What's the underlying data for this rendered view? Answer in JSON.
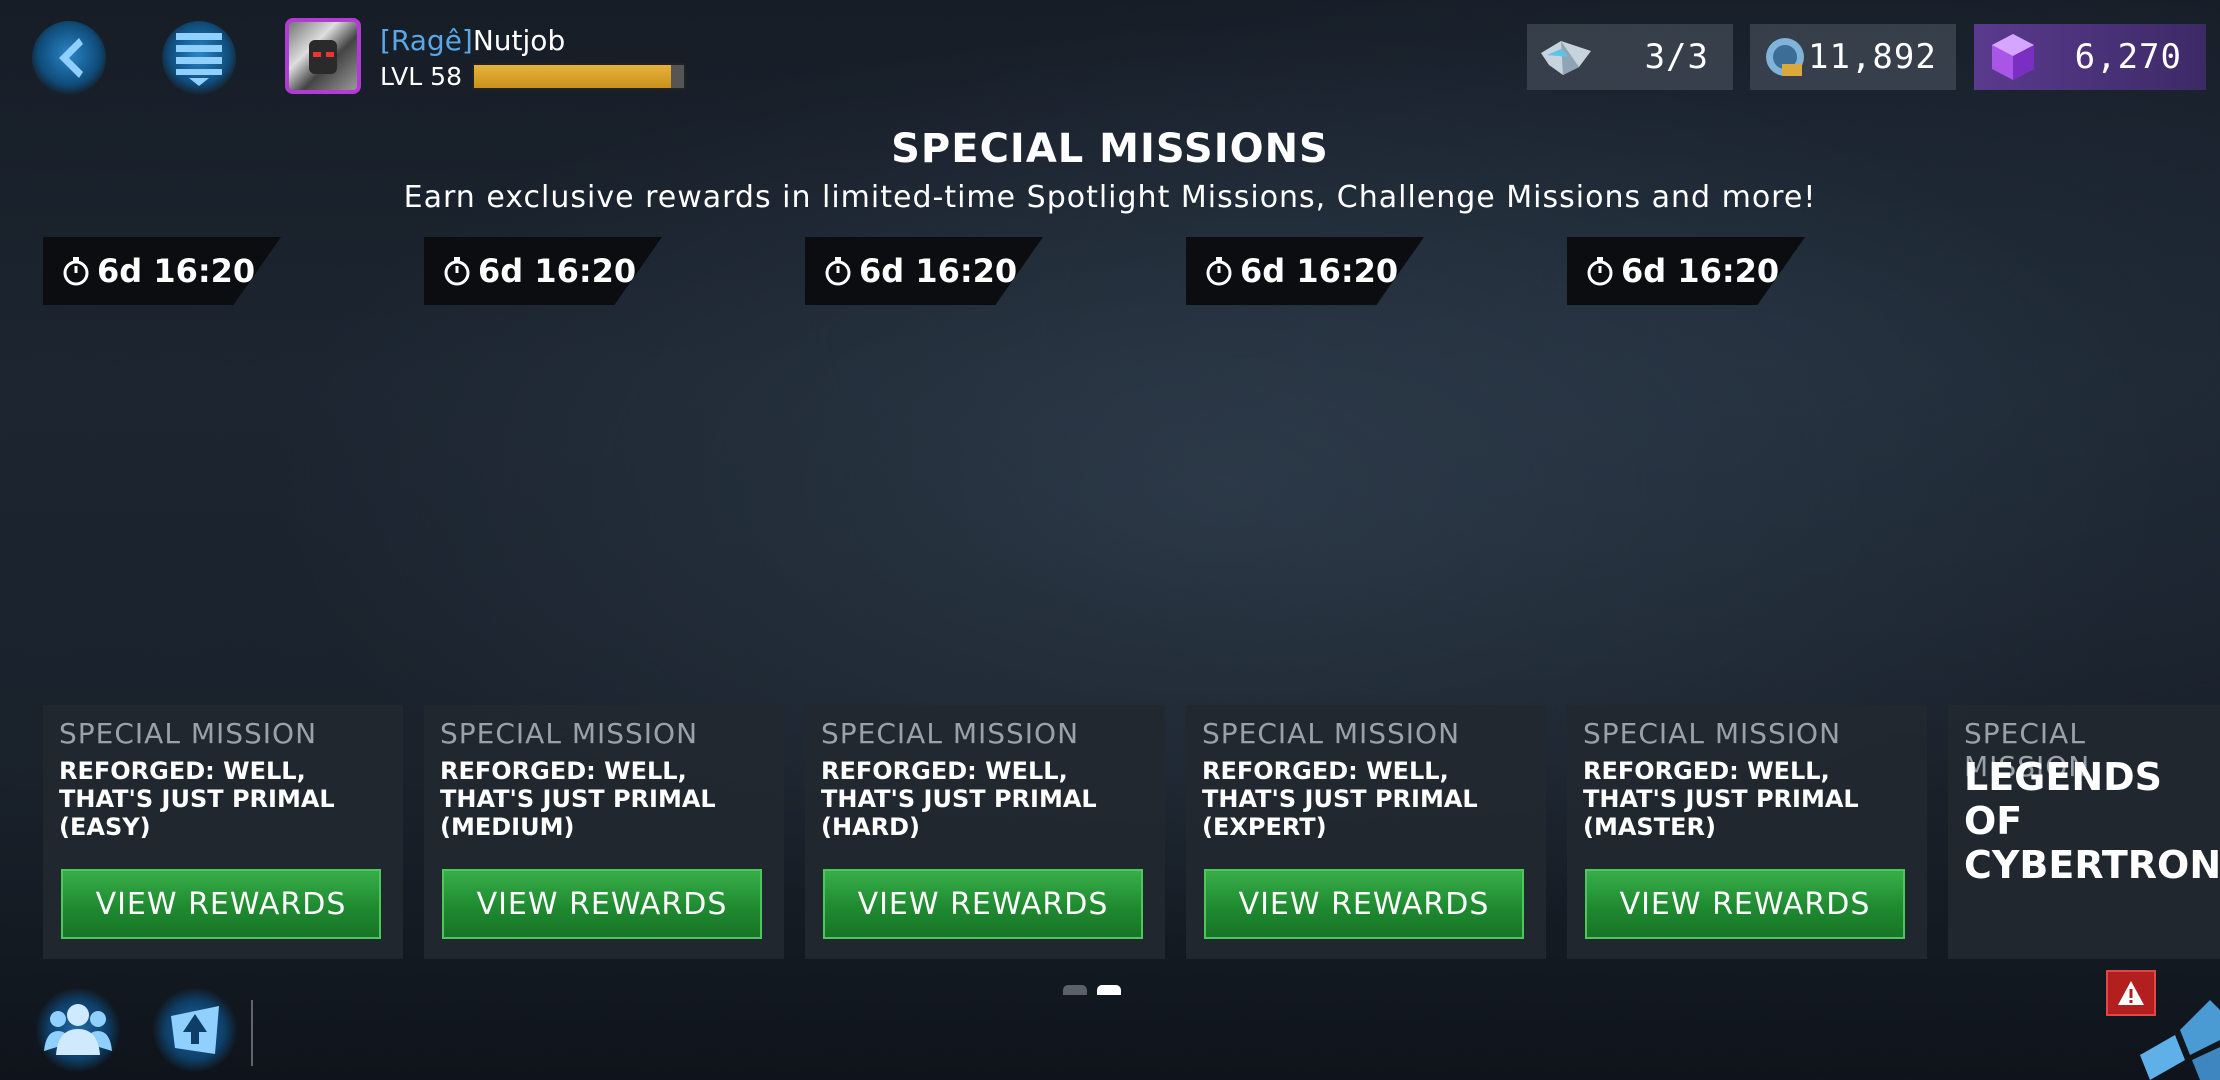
{
  "player": {
    "tag": "[Ragê]",
    "name": "Nutjob",
    "level": "LVL 58",
    "xp_fraction": 0.94
  },
  "currencies": {
    "energy": "3/3",
    "credits": "11,892",
    "gems": "6,270"
  },
  "header": {
    "title": "SPECIAL MISSIONS",
    "subtitle": "Earn exclusive rewards in limited-time Spotlight Missions, Challenge Missions and more!"
  },
  "missions": [
    {
      "timer": "6d 16:20",
      "label": "SPECIAL MISSION",
      "name": "REFORGED: WELL, THAT'S JUST PRIMAL (EASY)",
      "button": "VIEW REWARDS"
    },
    {
      "timer": "6d 16:20",
      "label": "SPECIAL MISSION",
      "name": "REFORGED: WELL, THAT'S JUST PRIMAL (MEDIUM)",
      "button": "VIEW REWARDS"
    },
    {
      "timer": "6d 16:20",
      "label": "SPECIAL MISSION",
      "name": "REFORGED: WELL, THAT'S JUST PRIMAL (HARD)",
      "button": "VIEW REWARDS"
    },
    {
      "timer": "6d 16:20",
      "label": "SPECIAL MISSION",
      "name": "REFORGED: WELL, THAT'S JUST PRIMAL (EXPERT)",
      "button": "VIEW REWARDS"
    },
    {
      "timer": "6d 16:20",
      "label": "SPECIAL MISSION",
      "name": "REFORGED: WELL, THAT'S JUST PRIMAL (MASTER)",
      "button": "VIEW REWARDS"
    },
    {
      "label": "SPECIAL MISSION",
      "name": "LEGENDS OF CYBERTRON"
    }
  ],
  "pager": {
    "pages": 2,
    "active": 2
  },
  "icons": [
    "back-chevron-icon",
    "menu-list-icon",
    "energon-icon",
    "credits-icon",
    "gem-icon",
    "clock-icon",
    "friends-icon",
    "alliance-icon",
    "alert-icon",
    "corner-icon"
  ],
  "colors": {
    "accent_blue": "#2a86c8",
    "button_green": "#1f8a30",
    "gem_purple": "#5a3a8e",
    "xp_gold": "#e7b23a",
    "alert_red": "#b31e1e"
  }
}
